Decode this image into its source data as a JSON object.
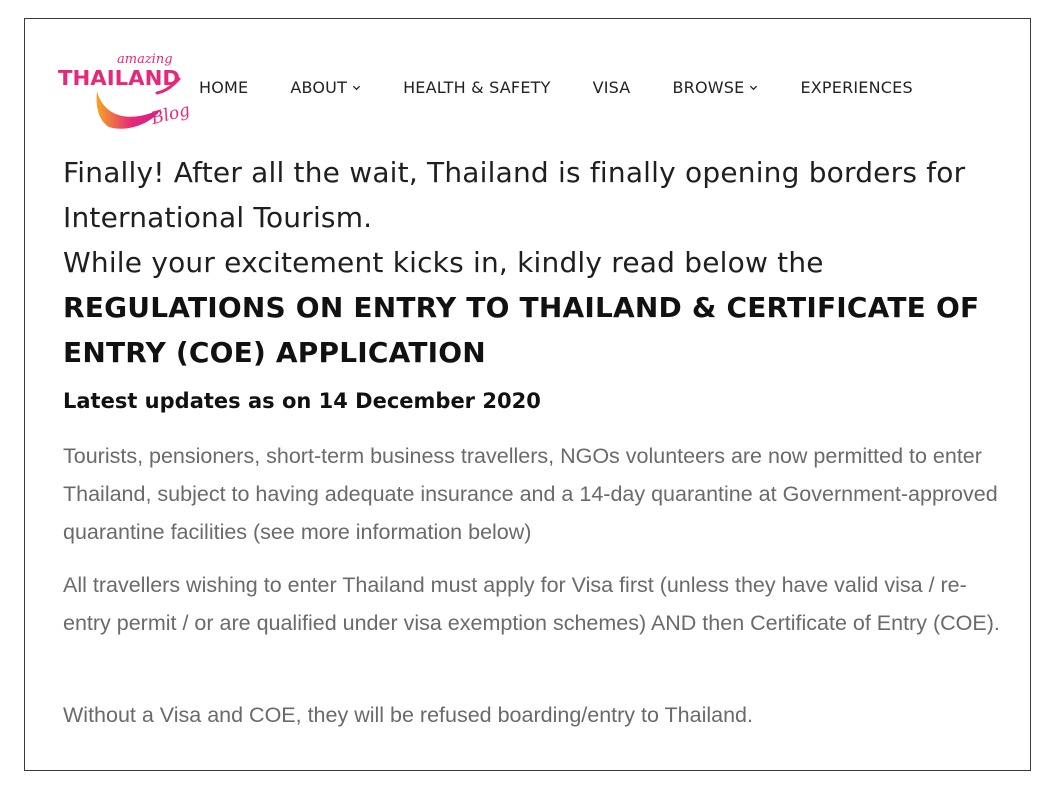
{
  "logo": {
    "top_text": "amazing",
    "main_text": "THAILAND",
    "script_text": "Blog"
  },
  "nav": {
    "items": [
      {
        "label": "HOME",
        "dropdown": false
      },
      {
        "label": "ABOUT",
        "dropdown": true
      },
      {
        "label": "HEALTH & SAFETY",
        "dropdown": false
      },
      {
        "label": "VISA",
        "dropdown": false
      },
      {
        "label": "BROWSE",
        "dropdown": true
      },
      {
        "label": "EXPERIENCES",
        "dropdown": false
      }
    ]
  },
  "content": {
    "intro_line1": "Finally! After all the wait, Thailand is finally opening borders for International Tourism.",
    "intro_line2": "While your excitement kicks in, kindly read below the",
    "heading": "REGULATIONS ON ENTRY TO THAILAND & CERTIFICATE OF ENTRY (COE) APPLICATION",
    "updates": "Latest updates as on 14 December 2020",
    "para1": "Tourists, pensioners, short-term business travellers, NGOs volunteers are now permitted to enter Thailand, subject to having adequate insurance and a 14-day quarantine at Government-approved quarantine facilities (see more information below)",
    "para2": "All travellers wishing to enter Thailand must apply for Visa first (unless they have valid visa / re-entry permit / or are qualified under visa exemption schemes) AND then Certificate of Entry (COE).",
    "para3": "Without a Visa and COE, they will be refused boarding/entry to Thailand."
  },
  "colors": {
    "logo_pink": "#e6287a",
    "logo_orange": "#f5a623",
    "logo_magenta": "#d01f8c",
    "body_grey": "#6a6a6a"
  }
}
